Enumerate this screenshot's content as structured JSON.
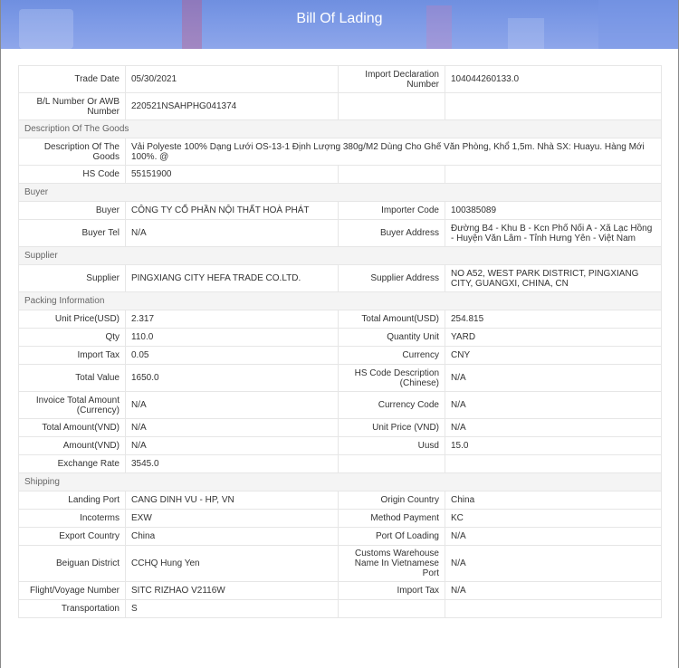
{
  "modal": {
    "title": "Bill Of Lading"
  },
  "basic": {
    "trade_date_label": "Trade Date",
    "trade_date": "05/30/2021",
    "import_decl_label": "Import Declaration Number",
    "import_decl": "104044260133.0",
    "bl_label": "B/L Number Or AWB Number",
    "bl": "220521NSAHPHG041374"
  },
  "goods": {
    "section": "Description Of The Goods",
    "desc_label": "Description Of The Goods",
    "desc": "Vải Polyeste 100% Dạng Lưới OS-13-1 Định Lượng 380g/M2 Dùng Cho Ghế Văn Phòng, Khổ 1,5m. Nhà SX: Huayu. Hàng Mới 100%. @",
    "hs_label": "HS Code",
    "hs": "55151900"
  },
  "buyer": {
    "section": "Buyer",
    "buyer_label": "Buyer",
    "buyer": "CÔNG TY CỔ PHẦN NỘI THẤT HOÀ PHÁT",
    "importer_code_label": "Importer Code",
    "importer_code": "100385089",
    "tel_label": "Buyer Tel",
    "tel": "N/A",
    "address_label": "Buyer Address",
    "address": "Đường B4 - Khu B - Kcn Phố Nối A - Xã Lạc Hồng - Huyện Văn Lâm - Tỉnh Hưng Yên - Việt Nam"
  },
  "supplier": {
    "section": "Supplier",
    "supplier_label": "Supplier",
    "supplier": "PINGXIANG CITY HEFA TRADE CO.LTD.",
    "address_label": "Supplier Address",
    "address": "NO A52, WEST PARK DISTRICT, PINGXIANG CITY, GUANGXI, CHINA, CN"
  },
  "packing": {
    "section": "Packing Information",
    "unit_price_usd_label": "Unit Price(USD)",
    "unit_price_usd": "2.317",
    "total_amount_usd_label": "Total Amount(USD)",
    "total_amount_usd": "254.815",
    "qty_label": "Qty",
    "qty": "110.0",
    "quantity_unit_label": "Quantity Unit",
    "quantity_unit": "YARD",
    "import_tax_label": "Import Tax",
    "import_tax": "0.05",
    "currency_label": "Currency",
    "currency": "CNY",
    "total_value_label": "Total Value",
    "total_value": "1650.0",
    "hs_desc_cn_label": "HS Code Description (Chinese)",
    "hs_desc_cn": "N/A",
    "invoice_total_label": "Invoice Total Amount (Currency)",
    "invoice_total": "N/A",
    "currency_code_label": "Currency Code",
    "currency_code": "N/A",
    "total_amount_vnd_label": "Total Amount(VND)",
    "total_amount_vnd": "N/A",
    "unit_price_vnd_label": "Unit Price (VND)",
    "unit_price_vnd": "N/A",
    "amount_vnd_label": "Amount(VND)",
    "amount_vnd": "N/A",
    "uusd_label": "Uusd",
    "uusd": "15.0",
    "exchange_rate_label": "Exchange Rate",
    "exchange_rate": "3545.0"
  },
  "shipping": {
    "section": "Shipping",
    "landing_port_label": "Landing Port",
    "landing_port": "CANG DINH VU - HP, VN",
    "origin_country_label": "Origin Country",
    "origin_country": "China",
    "incoterms_label": "Incoterms",
    "incoterms": "EXW",
    "method_payment_label": "Method Payment",
    "method_payment": "KC",
    "export_country_label": "Export Country",
    "export_country": "China",
    "port_of_loading_label": "Port Of Loading",
    "port_of_loading": "N/A",
    "beiguan_label": "Beiguan District",
    "beiguan": "CCHQ Hung Yen",
    "customs_wh_label": "Customs Warehouse Name In Vietnamese Port",
    "customs_wh": "N/A",
    "flight_label": "Flight/Voyage Number",
    "flight": "SITC RIZHAO V2116W",
    "import_tax_label": "Import Tax",
    "import_tax": "N/A",
    "transportation_label": "Transportation",
    "transportation": "S"
  }
}
